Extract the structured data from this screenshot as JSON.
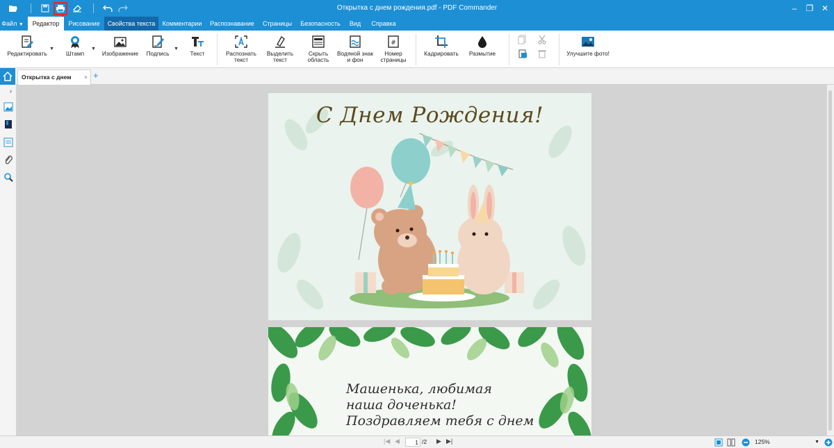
{
  "window": {
    "title": "Открытка с днем рождения.pdf - PDF Commander",
    "controls": {
      "minimize": "–",
      "maximize": "❐",
      "close": "✕"
    }
  },
  "quick_access": [
    "folder-open-icon",
    "save-icon",
    "print-icon",
    "eraser-icon",
    "undo-icon",
    "redo-icon"
  ],
  "menu": {
    "file": "Файл",
    "tabs": [
      "Редактор",
      "Рисование",
      "Свойства текста",
      "Комментарии",
      "Распознавание",
      "Страницы",
      "Безопасность",
      "Вид",
      "Справка"
    ],
    "active_tab": "Редактор",
    "context_tab": "Свойства текста"
  },
  "ribbon": {
    "edit": "Редактировать",
    "stamp": "Штамп",
    "image": "Изображение",
    "signature": "Подпись",
    "text": "Текст",
    "recognize_text": "Распознать текст",
    "select_text": "Выделить текст",
    "hide_area": "Скрыть область",
    "watermark": "Водяной знак и фон",
    "page_number": "Номер страницы",
    "crop": "Кадрировать",
    "blur": "Размытие",
    "enhance_photo": "Улучшите фото!"
  },
  "doc_tab": {
    "label": "Открытка с днем рожд...",
    "close": "×",
    "add": "+"
  },
  "document": {
    "page1_title": "С Днем Рождения!",
    "page2_lines": [
      "Машенька, любимая",
      "наша доченька!",
      "Поздравляем тебя с днем"
    ]
  },
  "status": {
    "current_page": "1",
    "total_pages": "/2",
    "zoom": "125%"
  },
  "colors": {
    "accent": "#1d8fd4",
    "highlight": "#e3262b",
    "workspace": "#d3d3d3"
  }
}
